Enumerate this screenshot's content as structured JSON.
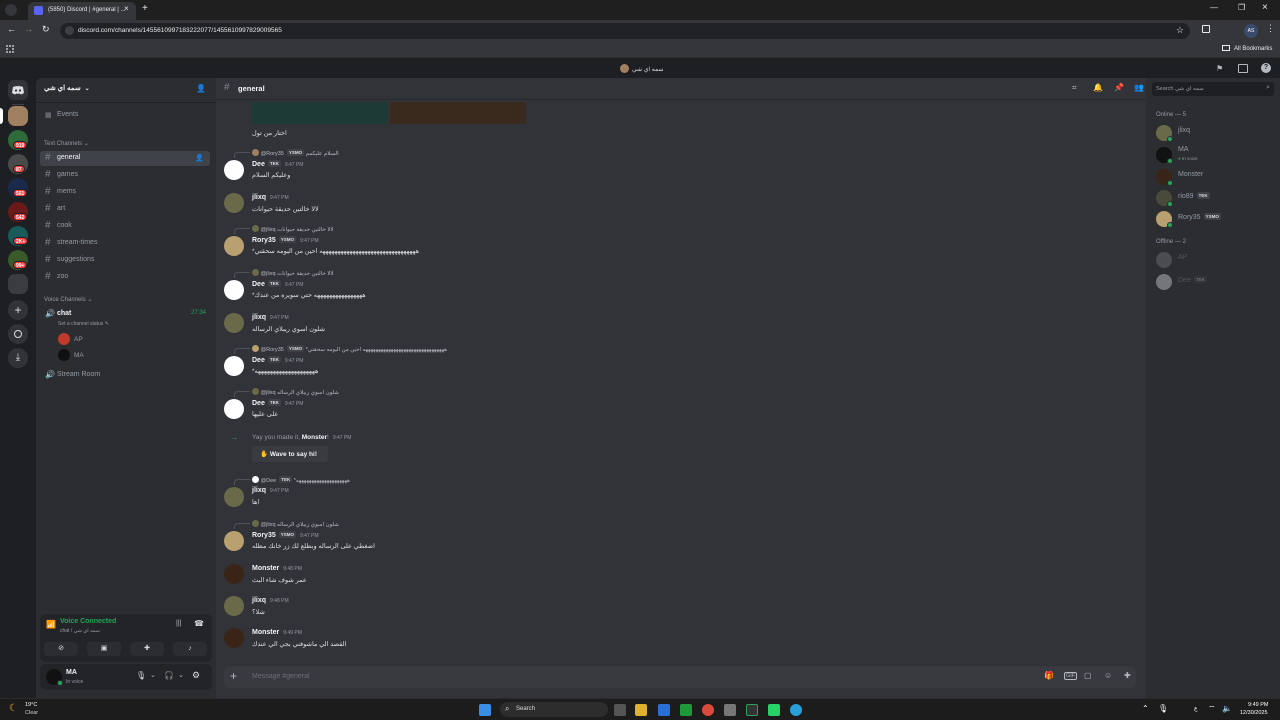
{
  "browser": {
    "tab_title": "(5850) Discord | #general | ...",
    "url": "discord.com/channels/1455610997183222077/1455610997829009565",
    "all_bookmarks": "All Bookmarks",
    "profile_initials": "AS"
  },
  "top_strip": {
    "server_name": "سمه اي شي"
  },
  "servers": [
    {
      "badge": ""
    },
    {
      "badge": "919"
    },
    {
      "badge": "87"
    },
    {
      "badge": "561"
    },
    {
      "badge": "542"
    },
    {
      "badge": "2K+"
    },
    {
      "badge": "99+"
    },
    {
      "badge": ""
    }
  ],
  "sidebar": {
    "server_title": "سمه اي شي",
    "events": "Events",
    "text_category": "Text Channels",
    "text_channels": [
      {
        "name": "general"
      },
      {
        "name": "games"
      },
      {
        "name": "mems"
      },
      {
        "name": "art"
      },
      {
        "name": "cook"
      },
      {
        "name": "stream-times"
      },
      {
        "name": "suggestions"
      },
      {
        "name": "zoo"
      }
    ],
    "voice_category": "Voice Channels",
    "voice_chat": {
      "name": "chat",
      "timer": "27:34",
      "status": "Set a channel status"
    },
    "voice_members": [
      {
        "name": "AP"
      },
      {
        "name": "MA"
      }
    ],
    "stream_room": "Stream Room"
  },
  "voice_panel": {
    "title": "Voice Connected",
    "subtitle": "chat / سمه اي شي"
  },
  "user_panel": {
    "name": "MA",
    "status": "In voice"
  },
  "chat_header": {
    "channel": "general",
    "search_placeholder": "Search سمه اي شي"
  },
  "messages": {
    "top_caption": "اختار من تول",
    "m1": {
      "reply_user": "@Rory35",
      "reply_badge": "YSMO",
      "reply_text": "السلام عليكمم",
      "user": "Dee",
      "badge": "TEK",
      "time": "9:47 PM",
      "text": "وعليكم السلام"
    },
    "m2": {
      "user": "jlixq",
      "time": "9:47 PM",
      "text": "لالا خالتين حديقة حيوانات"
    },
    "m3": {
      "reply_user": "@jlixq",
      "reply_text": "لالا خالتين حديقة حيوانات",
      "user": "Rory35",
      "badge": "YSMO",
      "time": "9:47 PM",
      "text": "*ههههههههههههههههههههههههههههههههه احين من اليومه سحقتي"
    },
    "m4": {
      "reply_user": "@jlixq",
      "reply_text": "لالا خالتين حديقة حيوانات",
      "user": "Dee",
      "badge": "TEK",
      "time": "9:47 PM",
      "text": "*ههههههههههههههههه حتي سويره من عندك"
    },
    "m5": {
      "user": "jlixq",
      "time": "9:47 PM",
      "text": "شلون اسوي ريبلاي الرساله"
    },
    "m6": {
      "reply_user": "@Rory35",
      "reply_badge": "YSMO",
      "reply_text": "*ههههههههههههههههههههههههههههههههه احين من اليومه سحقتي",
      "user": "Dee",
      "badge": "TEK",
      "time": "9:47 PM",
      "text": "*ههههههههههههههههههههه"
    },
    "m7": {
      "reply_user": "@jlixq",
      "reply_text": "شلون اسوي ريبلاي الرساله",
      "user": "Dee",
      "badge": "TEK",
      "time": "9:47 PM",
      "text": "على عليها"
    },
    "m8": {
      "prefix": "Yay you made it,",
      "user": "Monster",
      "suffix": "!",
      "time": "9:47 PM",
      "button": "Wave to say hi!"
    },
    "m9": {
      "reply_user": "@Dee",
      "reply_badge": "TEK",
      "reply_text": "*ههههههههههههههههههههه",
      "user": "jlixq",
      "time": "9:47 PM",
      "text": "اها"
    },
    "m10": {
      "reply_user": "@jlixq",
      "reply_text": "شلون اسوي ريبلاي الرساله",
      "user": "Rory35",
      "badge": "YSMO",
      "time": "9:47 PM",
      "text": "اضغطي على الرساله وبطلع لك زر خانك مظله"
    },
    "m11": {
      "user": "Monster",
      "time": "9:48 PM",
      "text": "عمر شوف شاء البث"
    },
    "m12": {
      "user": "jlixq",
      "time": "9:48 PM",
      "text": "شلا؟"
    },
    "m13": {
      "user": "Monster",
      "time": "9:49 PM",
      "text": "القصد الي ماشوفني بجي الي عندك"
    }
  },
  "composer": {
    "placeholder": "Message #general"
  },
  "members": {
    "online_header": "Online — 5",
    "online": [
      {
        "name": "jlixq",
        "badge": "",
        "sub": ""
      },
      {
        "name": "MA",
        "badge": "",
        "sub": "In voice"
      },
      {
        "name": "Monster",
        "badge": "",
        "sub": ""
      },
      {
        "name": "rio89",
        "badge": "TEK",
        "sub": ""
      },
      {
        "name": "Rory35",
        "badge": "YSMO",
        "sub": ""
      }
    ],
    "offline_header": "Offline — 2",
    "offline": [
      {
        "name": "AP",
        "badge": ""
      },
      {
        "name": "Dee",
        "badge": "TEK"
      }
    ]
  },
  "taskbar": {
    "weather_temp": "19°C",
    "weather_text": "Clear",
    "search": "Search",
    "time": "9:49 PM",
    "date": "12/30/2025"
  },
  "colors": {
    "accent": "#5865f2",
    "online": "#23a55a",
    "voice": "#23a55a",
    "badge": "#f23f42"
  }
}
